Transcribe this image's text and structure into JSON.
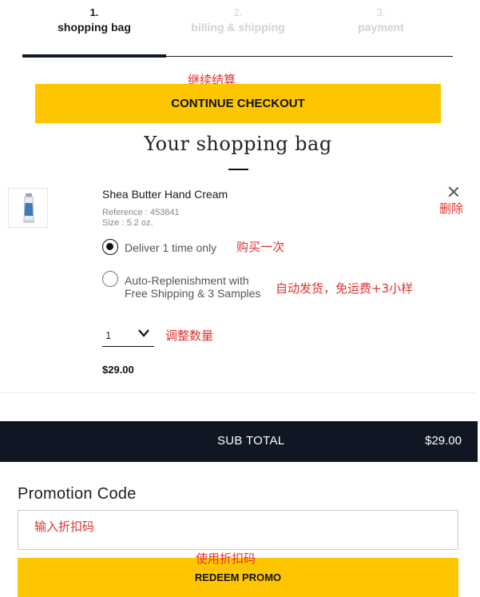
{
  "steps": [
    {
      "num": "1.",
      "label": "shopping bag"
    },
    {
      "num": "2.",
      "label": "billing & shipping"
    },
    {
      "num": "3.",
      "label": "payment"
    }
  ],
  "annotations": {
    "continue": "继续结算",
    "remove": "删除",
    "deliver_once": "购买一次",
    "auto_replenish": "自动发货，免运费+3小样",
    "adjust_qty": "调整数量",
    "promo_input": "输入折扣码",
    "use_promo": "使用折扣码"
  },
  "continue_checkout_label": "CONTINUE CHECKOUT",
  "bag_title": "Your shopping bag",
  "product": {
    "name": "Shea Butter Hand Cream",
    "reference": "Reference : 453841",
    "size": "Size : 5.2 oz.",
    "price": "$29.00",
    "thumbnail_icon": "hand-cream-tube-icon",
    "remove_icon": "close-icon"
  },
  "delivery_options": [
    {
      "label": "Deliver 1 time only",
      "selected": true
    },
    {
      "label_line1": "Auto-Replenishment with",
      "label_line2": "Free Shipping & 3 Samples",
      "selected": false
    }
  ],
  "quantity": {
    "value": "1",
    "icon": "chevron-down-icon"
  },
  "subtotal": {
    "label": "SUB TOTAL",
    "value": "$29.00"
  },
  "promo": {
    "title": "Promotion Code",
    "input_value": "",
    "redeem_label": "REDEEM PROMO"
  },
  "colors": {
    "accent_yellow": "#fec600",
    "dark_navy": "#0e1723",
    "annotation_red": "#e0322f"
  }
}
